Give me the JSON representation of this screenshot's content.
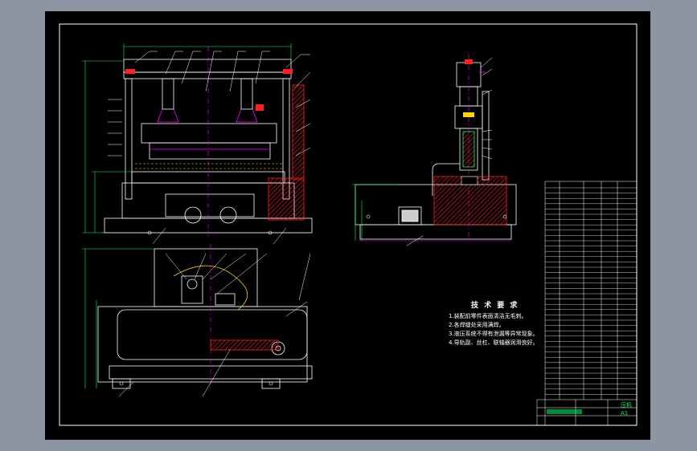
{
  "technical_requirements": {
    "title": "技 术 要 求",
    "items": [
      "1.装配前零件表面清洁无毛刺。",
      "2.各焊缝处采用满焊。",
      "3.液压系统不得有泄漏等异常现象。",
      "4.导轨副、丝杠、联轴器润滑良好。"
    ]
  },
  "title_block": {
    "label_1": "压机",
    "label_2": "A1"
  },
  "colors": {
    "background": "#000000",
    "outline": "#ffffff",
    "accent_magenta": "#ff00ff",
    "section_red": "#ff2020",
    "dimension_green": "#00ff66",
    "frame_gray": "#8c96a3",
    "hidden_yellow": "#ffd400"
  }
}
